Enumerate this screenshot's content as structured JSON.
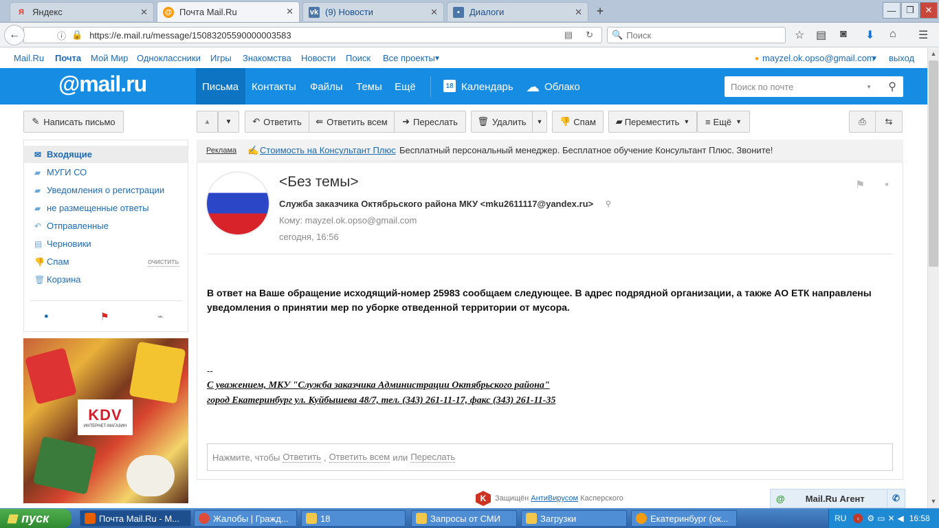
{
  "browser": {
    "tabs": [
      {
        "label": "Яндекс",
        "icon": "yandex-icon"
      },
      {
        "label": "Почта Mail.Ru",
        "icon": "mailru-icon"
      },
      {
        "label": "(9) Новости",
        "icon": "vk-icon"
      },
      {
        "label": "Диалоги",
        "icon": "chat-icon"
      }
    ],
    "url": "https://e.mail.ru/message/15083205590000003583",
    "search_placeholder": "Поиск"
  },
  "portal": {
    "links": [
      "Mail.Ru",
      "Почта",
      "Мой Мир",
      "Одноклассники",
      "Игры",
      "Знакомства",
      "Новости",
      "Поиск",
      "Все проекты"
    ],
    "user_email": "mayzel.ok.opso@gmail.com",
    "logout": "выход"
  },
  "header": {
    "logo": "@mail.ru",
    "nav": [
      "Письма",
      "Контакты",
      "Файлы",
      "Темы",
      "Ещё"
    ],
    "calendar": "Календарь",
    "calendar_day": "18",
    "cloud": "Облако",
    "search_placeholder": "Поиск по почте"
  },
  "toolbar": {
    "compose": "Написать письмо",
    "reply": "Ответить",
    "reply_all": "Ответить всем",
    "forward": "Переслать",
    "delete": "Удалить",
    "spam": "Спам",
    "move": "Переместить",
    "more": "Ещё"
  },
  "sidebar": {
    "folders": [
      {
        "label": "Входящие",
        "icon": "envelope-icon"
      },
      {
        "label": "МУГИ СО",
        "icon": "folder-icon"
      },
      {
        "label": "Уведомления о регистрации",
        "icon": "folder-icon"
      },
      {
        "label": "не размещенные ответы",
        "icon": "folder-icon"
      },
      {
        "label": "Отправленные",
        "icon": "sent-icon"
      },
      {
        "label": "Черновики",
        "icon": "draft-icon"
      },
      {
        "label": "Спам",
        "icon": "thumbs-down-icon"
      },
      {
        "label": "Корзина",
        "icon": "trash-icon"
      }
    ],
    "spam_clear": "очистить",
    "ad_brand": "KDV",
    "ad_sub": "ИНТЕРНЕТ-МАГАЗИН"
  },
  "ad": {
    "label": "Реклама",
    "link": "Стоимость на Консультант Плюс",
    "text": "Бесплатный персональный менеджер. Бесплатное обучение Консультант Плюс. Звоните!"
  },
  "message": {
    "subject": "<Без темы>",
    "from": "Служба заказчика Октябрьского района МКУ <mku2611117@yandex.ru>",
    "to": "Кому: mayzel.ok.opso@gmail.com",
    "date": "сегодня, 16:56",
    "body": "В ответ на Ваше обращение исходящий-номер 25983 сообщаем следующее. В адрес подрядной организации, а также АО ЕТК направлены уведомления о принятии мер по уборке отведенной территории от мусора.",
    "sig_dash": "--",
    "sig_line1": "С уважением, МКУ \"Служба заказчика Администрации Октябрьского района\"",
    "sig_line2": "город Екатеринбург ул. Куйбышева 48/7, тел. (343) 261-11-17, факс (343) 261-11-35",
    "quick_reply_prefix": "Нажмите, чтобы",
    "quick_reply": "Ответить",
    "quick_reply_all": "Ответить всем",
    "quick_or": "или",
    "quick_forward": "Переслать"
  },
  "footer": {
    "protected": "Защищён",
    "antivirus": "АнтиВирусом",
    "vendor": "Касперского",
    "agent": "Mail.Ru Агент"
  },
  "taskbar": {
    "start": "пуск",
    "items": [
      "Почта Mail.Ru - M...",
      "Жалобы | Гражд...",
      "18",
      "Запросы от СМИ",
      "Загрузки",
      "Екатеринбург (ок..."
    ],
    "lang": "RU",
    "clock": "16:58"
  },
  "colors": {
    "accent": "#168de2",
    "link": "#1a6ab4",
    "taskbar": "#2f63a7"
  }
}
